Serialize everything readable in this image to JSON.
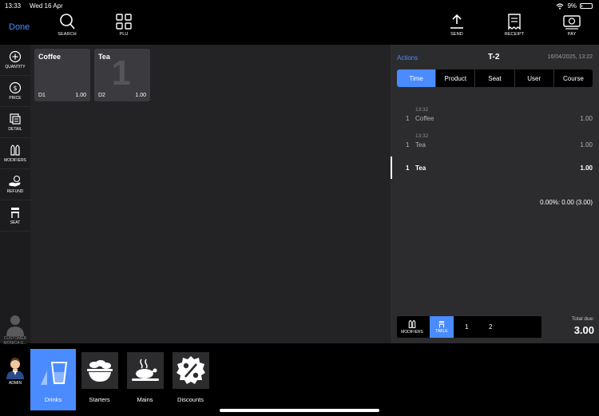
{
  "status_bar": {
    "time": "13:33",
    "date": "Wed 16 Apr",
    "battery": "9%",
    "battery_level": 0.09
  },
  "toolbar": {
    "done_label": "Done",
    "search_label": "SEARCH",
    "plu_label": "PLU",
    "send_label": "SEND",
    "receipt_label": "RECEIPT",
    "pay_label": "PAY"
  },
  "sidebar": {
    "items": [
      {
        "label": "QUANTITY",
        "icon": "plus-circle-icon"
      },
      {
        "label": "PRICE",
        "icon": "dollar-circle-icon"
      },
      {
        "label": "DETAIL",
        "icon": "detail-icon"
      },
      {
        "label": "MODIFIERS",
        "icon": "modifiers-icon"
      },
      {
        "label": "REFUND",
        "icon": "refund-icon"
      },
      {
        "label": "SEAT",
        "icon": "seat-icon"
      }
    ],
    "customer_label": "CUSTOMER",
    "customer_name": "MONICA G...",
    "admin_label": "ADMIN"
  },
  "products": [
    {
      "name": "Coffee",
      "code": "D1",
      "qty": "1.00"
    },
    {
      "name": "Tea",
      "code": "D2",
      "qty": "1.00",
      "badge": "1"
    }
  ],
  "order": {
    "actions_label": "Actions",
    "table": "T-2",
    "date": "16/04/2025, 13:22",
    "sort_tabs": [
      "Time",
      "Product",
      "Seat",
      "User",
      "Course"
    ],
    "active_tab": "Time",
    "items": [
      {
        "time": "13:32",
        "qty": "1",
        "name": "Coffee",
        "price": "1.00"
      },
      {
        "time": "13:32",
        "qty": "1",
        "name": "Tea",
        "price": "1.00"
      },
      {
        "time": "",
        "qty": "1",
        "name": "Tea",
        "price": "1.00"
      }
    ],
    "discount_line": "0.00%: 0.00 (3.00)",
    "modifiers_label": "MODIFIERS",
    "table_label": "TABLE",
    "seat_numbers": [
      "1",
      "2"
    ],
    "total_label": "Total due:",
    "total_value": "3.00"
  },
  "categories": [
    {
      "label": "Drinks",
      "active": true
    },
    {
      "label": "Starters"
    },
    {
      "label": "Mains"
    },
    {
      "label": "Discounts"
    }
  ],
  "colors": {
    "accent": "#4a8cff",
    "panel": "#2c2c2e",
    "main_bg": "#232326",
    "tile": "#3a3a3f"
  }
}
